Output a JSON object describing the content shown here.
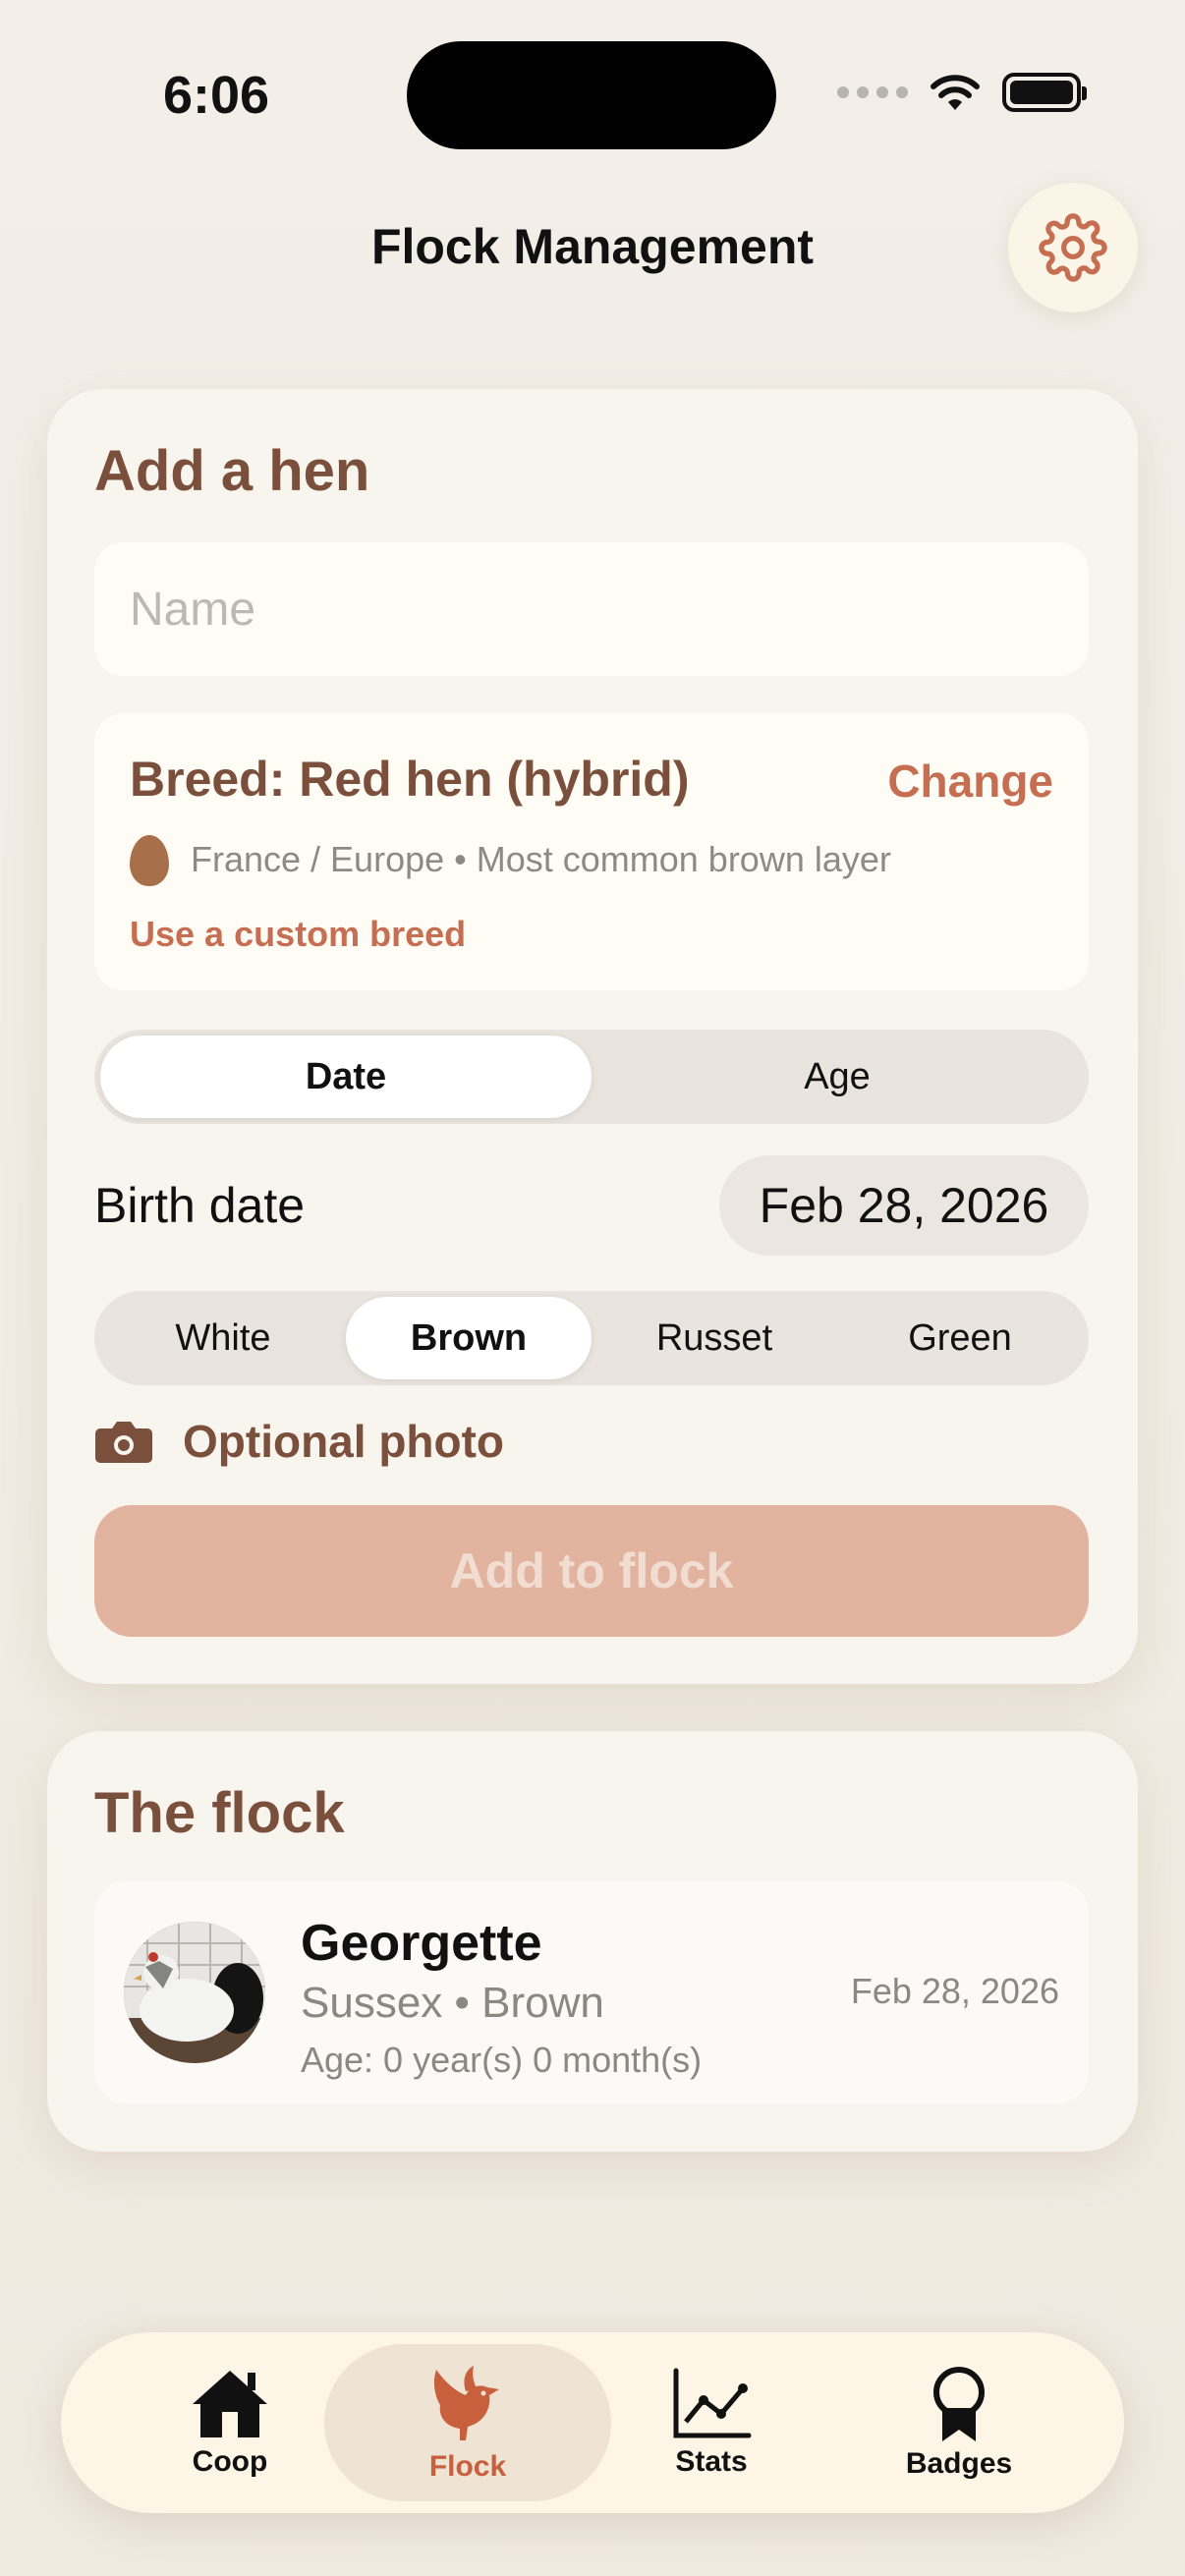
{
  "status": {
    "time": "6:06"
  },
  "header": {
    "title": "Flock Management"
  },
  "add_hen": {
    "title": "Add a hen",
    "name_placeholder": "Name",
    "breed_title": "Breed: Red hen (hybrid)",
    "breed_change": "Change",
    "breed_meta": "France / Europe • Most common brown layer",
    "custom_breed": "Use a custom breed",
    "mode_tabs": [
      "Date",
      "Age"
    ],
    "mode_selected": "Date",
    "birth_label": "Birth date",
    "birth_date": "Feb 28, 2026",
    "egg_colors": [
      "White",
      "Brown",
      "Russet",
      "Green"
    ],
    "egg_color_selected": "Brown",
    "photo_label": "Optional photo",
    "submit_label": "Add to flock"
  },
  "flock": {
    "title": "The flock",
    "hens": [
      {
        "name": "Georgette",
        "subtitle": "Sussex • Brown",
        "age": "Age: 0 year(s) 0 month(s)",
        "date": "Feb 28, 2026"
      }
    ]
  },
  "tabbar": {
    "items": [
      {
        "label": "Coop",
        "icon": "house-icon"
      },
      {
        "label": "Flock",
        "icon": "bird-icon"
      },
      {
        "label": "Stats",
        "icon": "chart-line-icon"
      },
      {
        "label": "Badges",
        "icon": "medal-icon"
      }
    ],
    "selected": "Flock"
  },
  "colors": {
    "accent": "#c66e52",
    "brown_text": "#7a4f3c",
    "button_disabled": "#e2b4a0"
  }
}
